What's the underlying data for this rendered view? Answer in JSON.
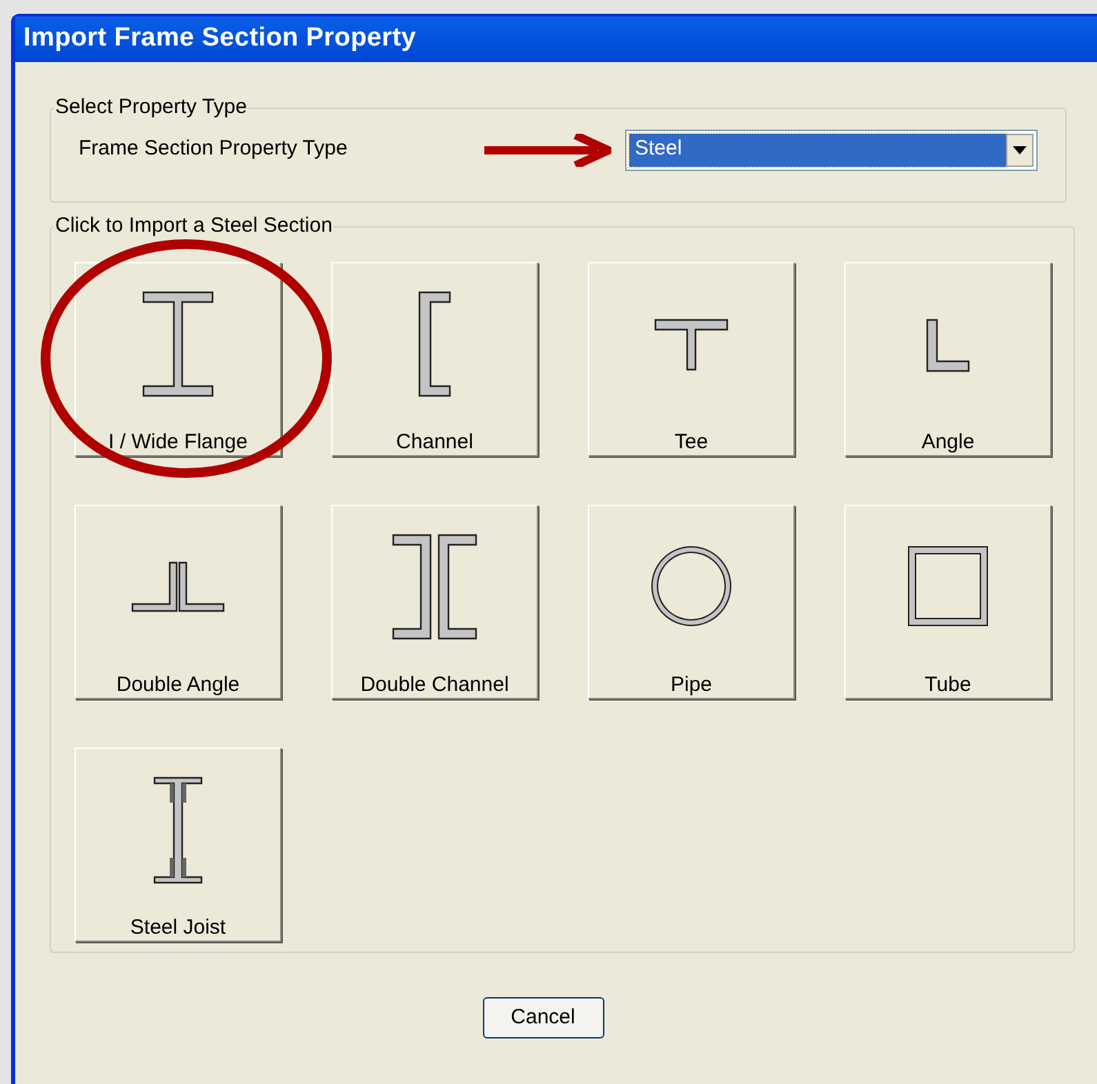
{
  "window": {
    "title": "Import Frame Section Property"
  },
  "property_group": {
    "title": "Select Property Type",
    "label": "Frame Section Property Type",
    "dropdown": {
      "value": "Steel"
    }
  },
  "section_group": {
    "title": "Click to Import a Steel Section",
    "sections": [
      {
        "kind": "i_beam",
        "label": "I / Wide Flange"
      },
      {
        "kind": "channel",
        "label": "Channel"
      },
      {
        "kind": "tee",
        "label": "Tee"
      },
      {
        "kind": "angle",
        "label": "Angle"
      },
      {
        "kind": "double_angle",
        "label": "Double Angle"
      },
      {
        "kind": "double_channel",
        "label": "Double Channel"
      },
      {
        "kind": "pipe",
        "label": "Pipe"
      },
      {
        "kind": "tube",
        "label": "Tube"
      },
      {
        "kind": "joist",
        "label": "Steel Joist"
      }
    ]
  },
  "buttons": [
    {
      "label": "Cancel"
    }
  ]
}
